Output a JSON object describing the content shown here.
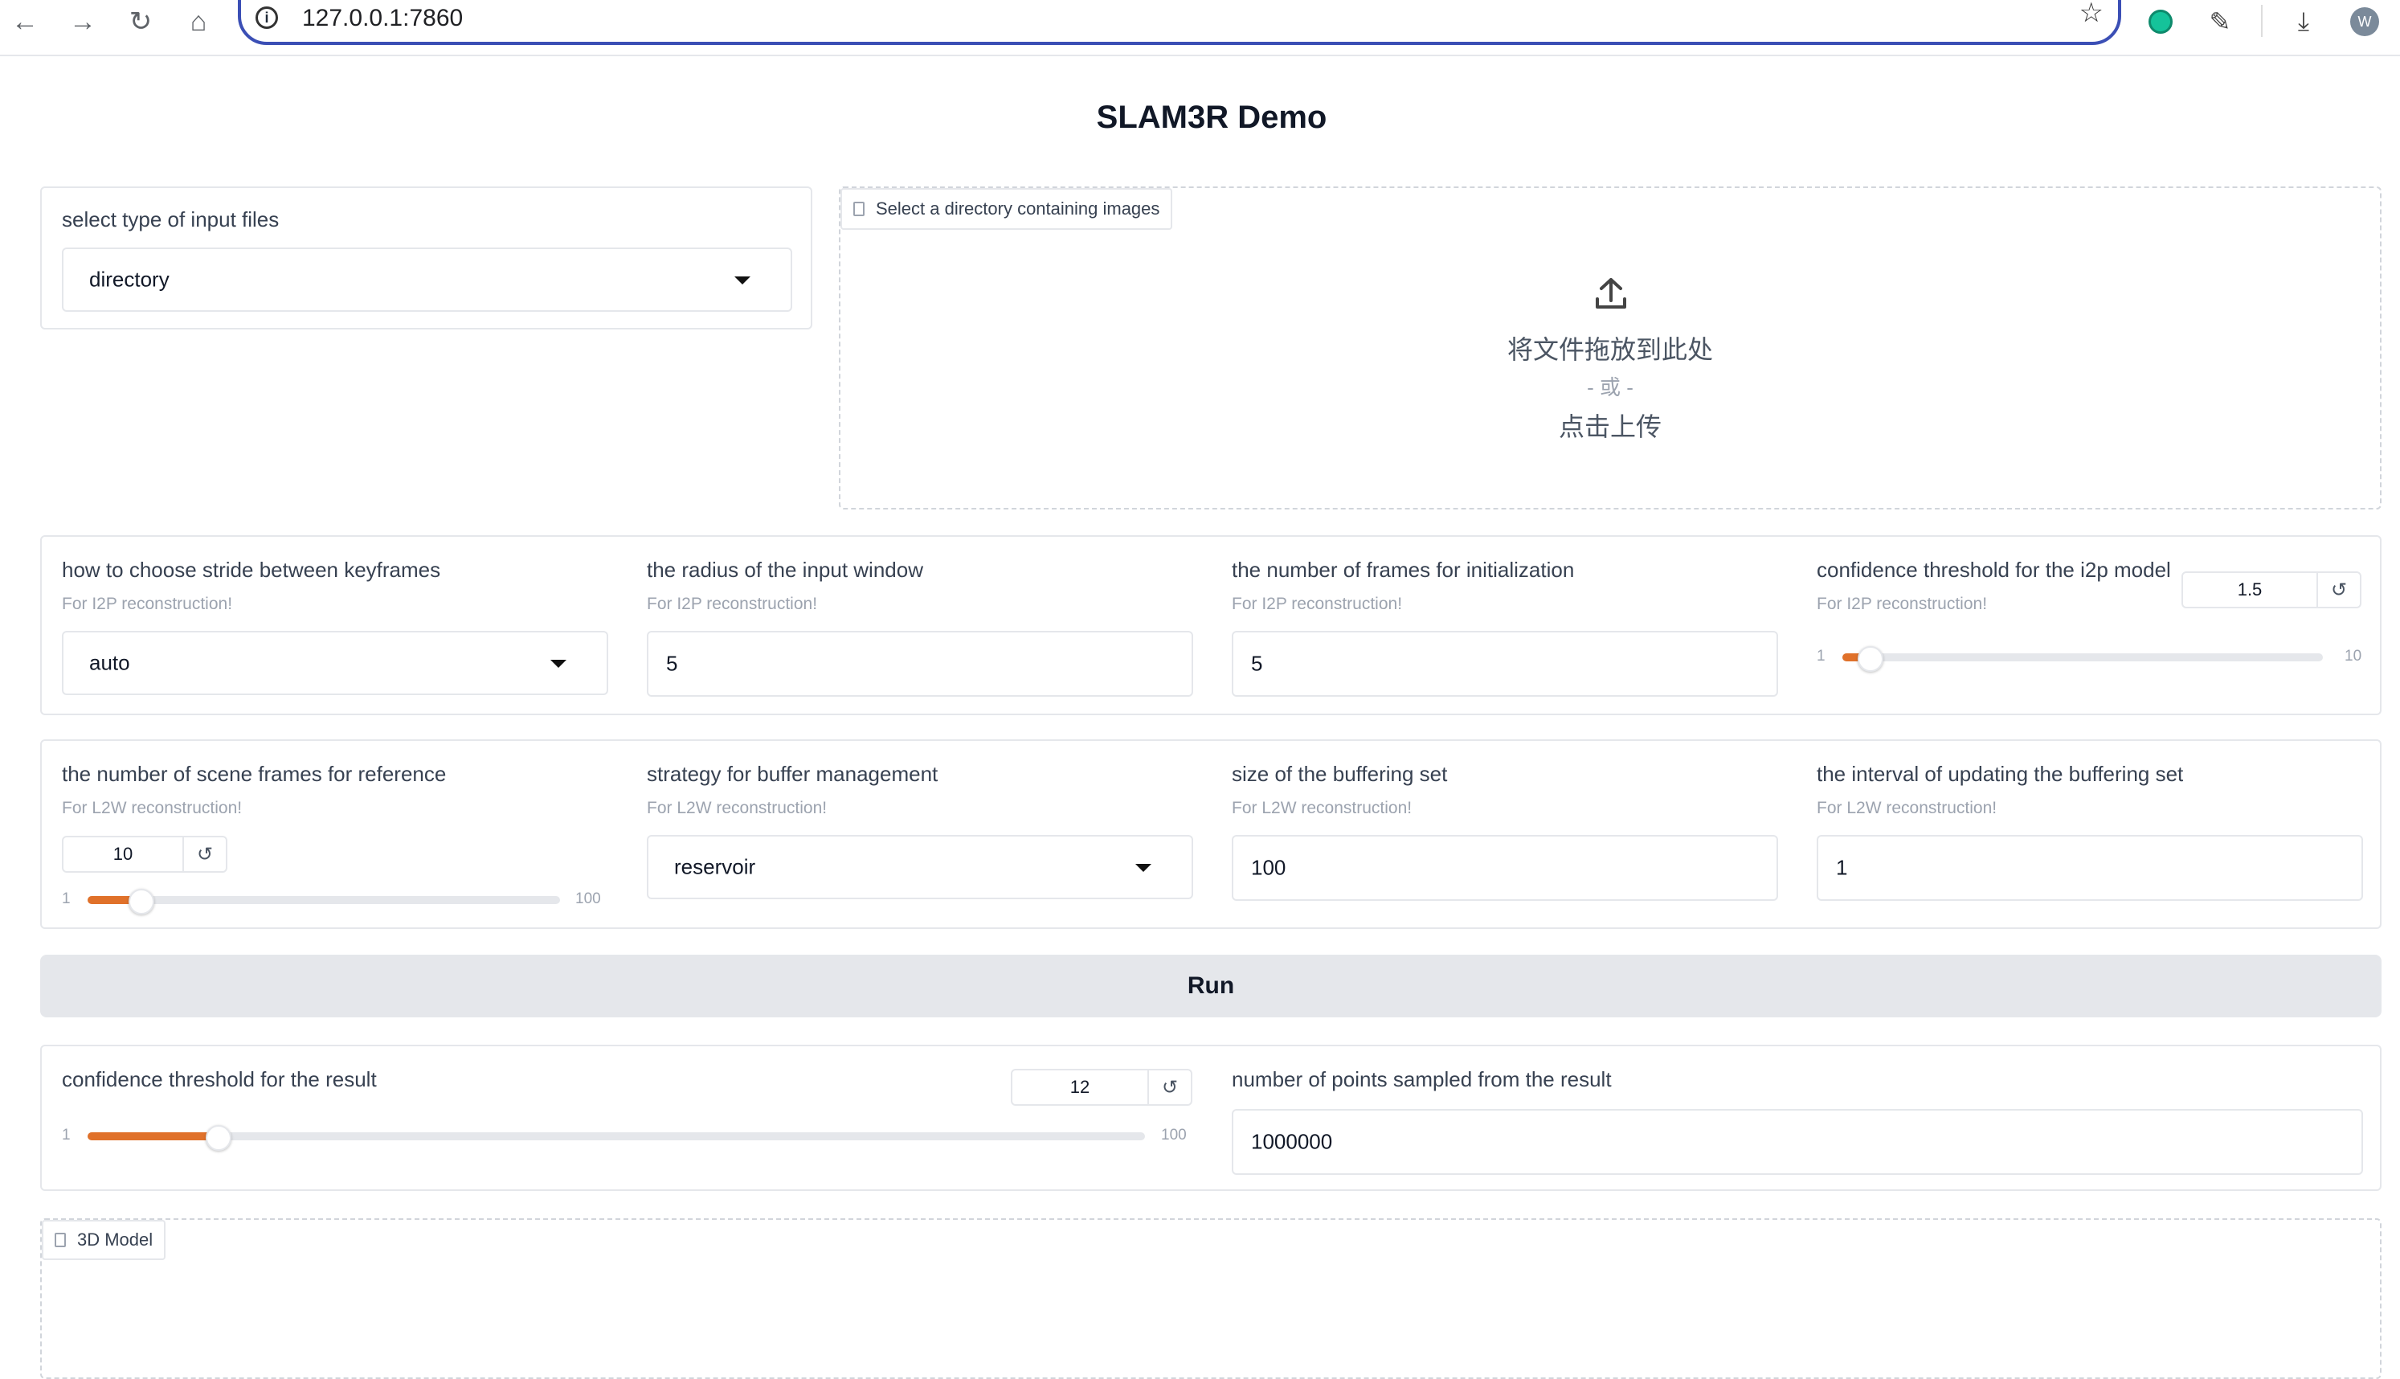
{
  "browser": {
    "url": "127.0.0.1:7860",
    "avatar_letter": "W"
  },
  "page": {
    "title": "SLAM3R Demo"
  },
  "input_type": {
    "label": "select type of input files",
    "value": "directory"
  },
  "upload": {
    "tab_label": "Select a directory containing images",
    "drop_text": "将文件拖放到此处",
    "or_text": "- 或 -",
    "click_text": "点击上传"
  },
  "row1": {
    "stride": {
      "label": "how to choose stride between keyframes",
      "info": "For I2P reconstruction!",
      "value": "auto"
    },
    "radius": {
      "label": "the radius of the input window",
      "info": "For I2P reconstruction!",
      "value": "5"
    },
    "init_frames": {
      "label": "the number of frames for initialization",
      "info": "For I2P reconstruction!",
      "value": "5"
    },
    "conf_i2p": {
      "label": "confidence threshold for the i2p model",
      "info": "For I2P reconstruction!",
      "value": "1.5",
      "min": "1",
      "max": "10",
      "level": 0.055
    }
  },
  "row2": {
    "scene_frames": {
      "label": "the number of scene frames for reference",
      "info": "For L2W reconstruction!",
      "value": "10",
      "min": "1",
      "max": "100",
      "level": 0.11
    },
    "buffer_strategy": {
      "label": "strategy for buffer management",
      "info": "For L2W reconstruction!",
      "value": "reservoir"
    },
    "buffer_size": {
      "label": "size of the buffering set",
      "info": "For L2W reconstruction!",
      "value": "100"
    },
    "buffer_interval": {
      "label": "the interval of updating the buffering set",
      "info": "For L2W reconstruction!",
      "value": "1"
    }
  },
  "run_button": {
    "label": "Run"
  },
  "result": {
    "conf": {
      "label": "confidence threshold for the result",
      "value": "12",
      "min": "1",
      "max": "100",
      "level": 0.122
    },
    "points": {
      "label": "number of points sampled from the result",
      "value": "1000000"
    }
  },
  "model3d": {
    "tab_label": "3D Model"
  },
  "colors": {
    "accent": "#e0712a",
    "url_border": "#3b4fb5",
    "button_bg": "#e5e7eb"
  },
  "icons": [
    "back-arrow-icon",
    "forward-arrow-icon",
    "reload-icon",
    "home-icon",
    "site-info-icon",
    "star-icon",
    "grammarly-icon",
    "extensions-icon",
    "download-icon",
    "upload-icon",
    "file-icon",
    "reset-icon",
    "dropdown-caret-icon"
  ]
}
